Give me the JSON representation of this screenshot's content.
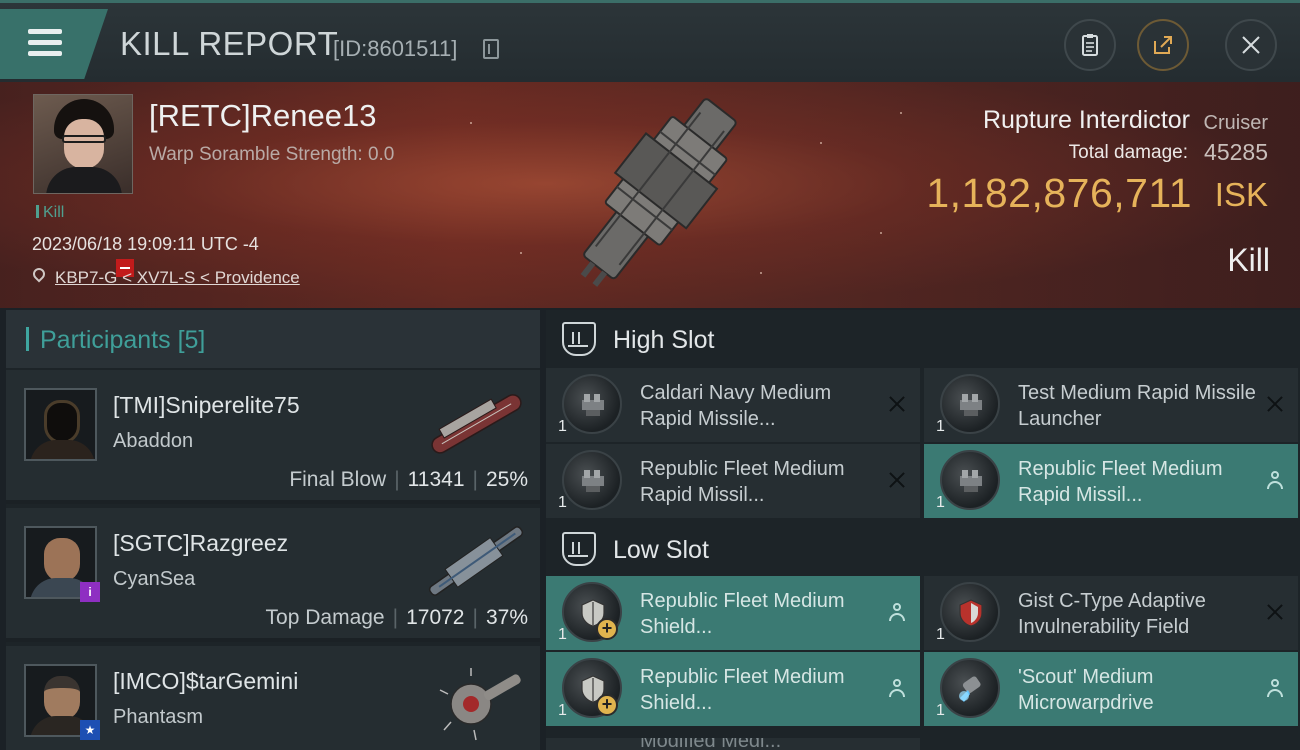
{
  "window": {
    "title": "KILL REPORT",
    "report_id": "[ID:8601511]"
  },
  "toolbar": {
    "menu_icon": "hamburger-menu-icon",
    "buttons": [
      "clipboard-icon",
      "share-icon",
      "close-icon"
    ]
  },
  "victim": {
    "name": "[RETC]Renee13",
    "scramble": "Warp Soramble Strength: 0.0",
    "kill_tag": "Kill",
    "timestamp": "2023/06/18 19:09:11 UTC -4",
    "location": "KBP7-G < XV7L-S < Providence",
    "ship_name": "Rupture Interdictor",
    "ship_class": "Cruiser",
    "damage_label": "Total damage:",
    "damage_value": "45285",
    "isk_value": "1,182,876,711",
    "isk_unit": "ISK",
    "result": "Kill"
  },
  "participants": {
    "header": "Participants",
    "count": "[5]",
    "rows": [
      {
        "name": "[TMI]Sniperelite75",
        "ship": "Abaddon",
        "stat_label": "Final Blow",
        "damage": "11341",
        "percent": "25%",
        "badge": ""
      },
      {
        "name": "[SGTC]Razgreez",
        "ship": "CyanSea",
        "stat_label": "Top Damage",
        "damage": "17072",
        "percent": "37%",
        "badge": "i"
      },
      {
        "name": "[IMCO]$tarGemini",
        "ship": "Phantasm",
        "stat_label": "",
        "damage": "",
        "percent": "",
        "badge": "★"
      }
    ]
  },
  "fitting": {
    "high_slot": {
      "title": "High Slot",
      "modules": [
        {
          "name": "Caldari Navy Medium Rapid Missile...",
          "qty": "1",
          "state": "destroyed"
        },
        {
          "name": "Test Medium Rapid Missile Launcher",
          "qty": "1",
          "state": "destroyed"
        },
        {
          "name": "Republic Fleet Medium Rapid Missil...",
          "qty": "1",
          "state": "destroyed"
        },
        {
          "name": "Republic Fleet Medium Rapid Missil...",
          "qty": "1",
          "state": "dropped"
        }
      ]
    },
    "low_slot": {
      "title": "Low Slot",
      "modules": [
        {
          "name": "Republic Fleet Medium Shield...",
          "qty": "1",
          "state": "dropped"
        },
        {
          "name": "Gist C-Type Adaptive Invulnerability Field",
          "qty": "1",
          "state": "destroyed"
        },
        {
          "name": "Republic Fleet Medium Shield...",
          "qty": "1",
          "state": "dropped"
        },
        {
          "name": "'Scout' Medium Microwarpdrive",
          "qty": "1",
          "state": "dropped"
        }
      ]
    },
    "peek_text": "Modified Medi..."
  }
}
